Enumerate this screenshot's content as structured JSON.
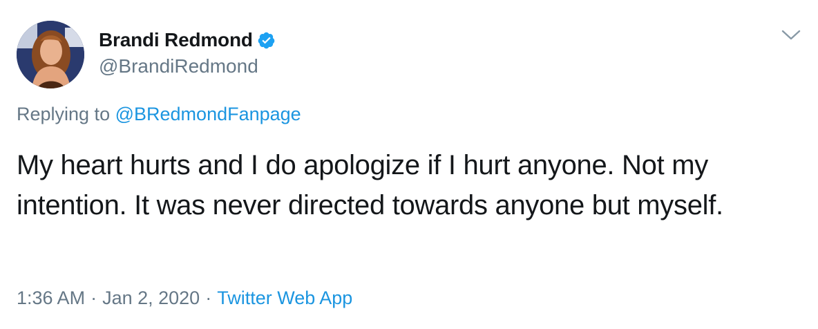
{
  "tweet": {
    "author": {
      "display_name": "Brandi Redmond",
      "handle": "@BrandiRedmond",
      "verified": true,
      "avatar_icon": "profile-photo"
    },
    "reply": {
      "prefix": "Replying to",
      "mention": "@BRedmondFanpage"
    },
    "text": "My heart hurts and I do apologize if I hurt anyone. Not my intention. It was never directed towards anyone but myself.",
    "meta": {
      "time": "1:36 AM",
      "separator": "·",
      "date": "Jan 2, 2020",
      "source": "Twitter Web App"
    },
    "menu_icon": "chevron-down-icon"
  },
  "colors": {
    "text_primary": "#14171a",
    "text_secondary": "#657786",
    "link": "#1b95e0",
    "verified": "#1da1f2"
  }
}
